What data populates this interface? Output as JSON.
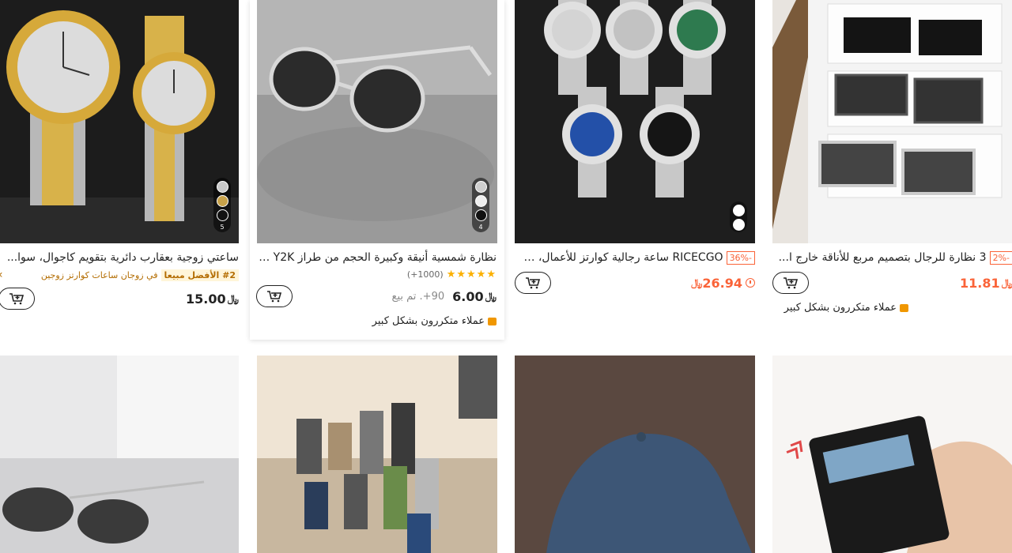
{
  "products": [
    {
      "title": "ساعتي زوجية بعقارب دائرية بتقويم كاجوال، سوا...",
      "rank_badge": "#2 الأفضل مبيعا",
      "rank_text": "في زوجان ساعات كوارتز زوجين",
      "price": "15.00",
      "swatch_count": "5",
      "colors": [
        "#c9c9c9",
        "#c8a24a",
        "#111111"
      ]
    },
    {
      "title": "نظارة شمسية أنيقة وكبيرة الحجم من طراز Y2K ا...",
      "stars": "★★★★★",
      "reviews": "(1000+)",
      "price": "6.00",
      "sold": "90+. تم بيع",
      "note": "عملاء متكررون بشكل كبير",
      "swatch_count": "4",
      "colors": [
        "#cfcfcf",
        "#e8e8e8",
        "#111111"
      ]
    },
    {
      "discount": "-36%",
      "title": "RICECGO ساعة رجالية كوارتز للأعمال، س...",
      "price": "26.94"
    },
    {
      "discount": "-2%",
      "title": "3 نظارة للرجال بتصميم مربع للأناقة خارج ا...",
      "price": "11.81",
      "note": "عملاء متكررون بشكل كبير"
    }
  ],
  "currency": "﷼",
  "colors": {
    "accent": "#fa6338",
    "gold": "#f09700"
  }
}
